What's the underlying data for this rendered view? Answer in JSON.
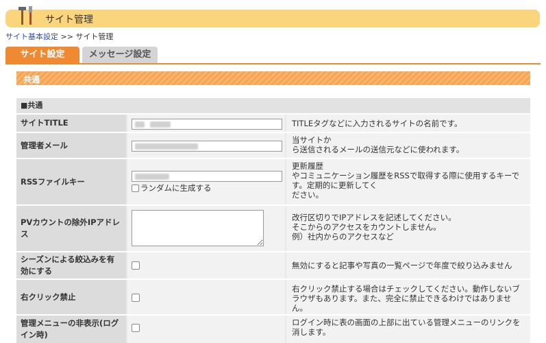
{
  "header": {
    "title": "サイト管理",
    "icon": "tools-icon"
  },
  "breadcrumb": {
    "parent": "サイト基本設定",
    "separator": ">>",
    "current": "サイト管理"
  },
  "tabs": [
    {
      "label": "サイト設定"
    },
    {
      "label": "メッセージ設定"
    }
  ],
  "section": {
    "title": "共通"
  },
  "group": {
    "title": "■共通"
  },
  "rows": [
    {
      "label": "サイトTITLE",
      "desc": "TITLEタグなどに入力されるサイトの名前です。"
    },
    {
      "label": "管理者メール",
      "desc": "当サイトか\nら送信されるメールの送信元などに使われます。"
    },
    {
      "label": "RSSファイルキー",
      "checkbox_label": "ランダムに生成する",
      "desc": "更新履歴\nやコミュニケーション履歴をRSSで取得する際に使用するキーです。定期的に更新してく\nださい。"
    },
    {
      "label": "PVカウントの除外IPアドレス",
      "desc": "改行区切りでIPアドレスを記述してください。\nそこからのアクセスをカウントしません。\n例）社内からのアクセスなど"
    },
    {
      "label": "シーズンによる絞込みを有効にする",
      "desc": "無効にすると記事や写真の一覧ページで年度で絞り込みません"
    },
    {
      "label": "右クリック禁止",
      "desc": "右クリック禁止する場合はチェックしてください。動作しないブラウザもあります。また、完全に禁止できるわけではありません。"
    },
    {
      "label": "管理メニューの非表示(ログイン時)",
      "desc": "ログイン時に表の画面の上部に出ている管理メニューのリンクを消します。"
    }
  ],
  "colors": {
    "accent": "#f08a32",
    "header_bg": "#fbd57e",
    "link": "#2a4fb0"
  }
}
